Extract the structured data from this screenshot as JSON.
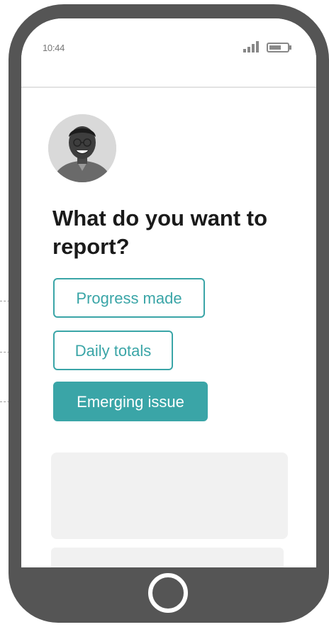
{
  "status_bar": {
    "time": "10:44",
    "signal_icon": "signal-bars-icon",
    "battery_icon": "battery-icon"
  },
  "question": {
    "title": "What do you want to report?"
  },
  "choices": [
    {
      "label": "Progress made",
      "style": "outline"
    },
    {
      "label": "Daily totals",
      "style": "outline"
    },
    {
      "label": "Emerging issue",
      "style": "filled"
    }
  ],
  "colors": {
    "accent": "#3aa5a7",
    "phone_frame": "#555555",
    "placeholder": "#f1f1f1"
  },
  "home_button_icon": "home-circle-icon"
}
